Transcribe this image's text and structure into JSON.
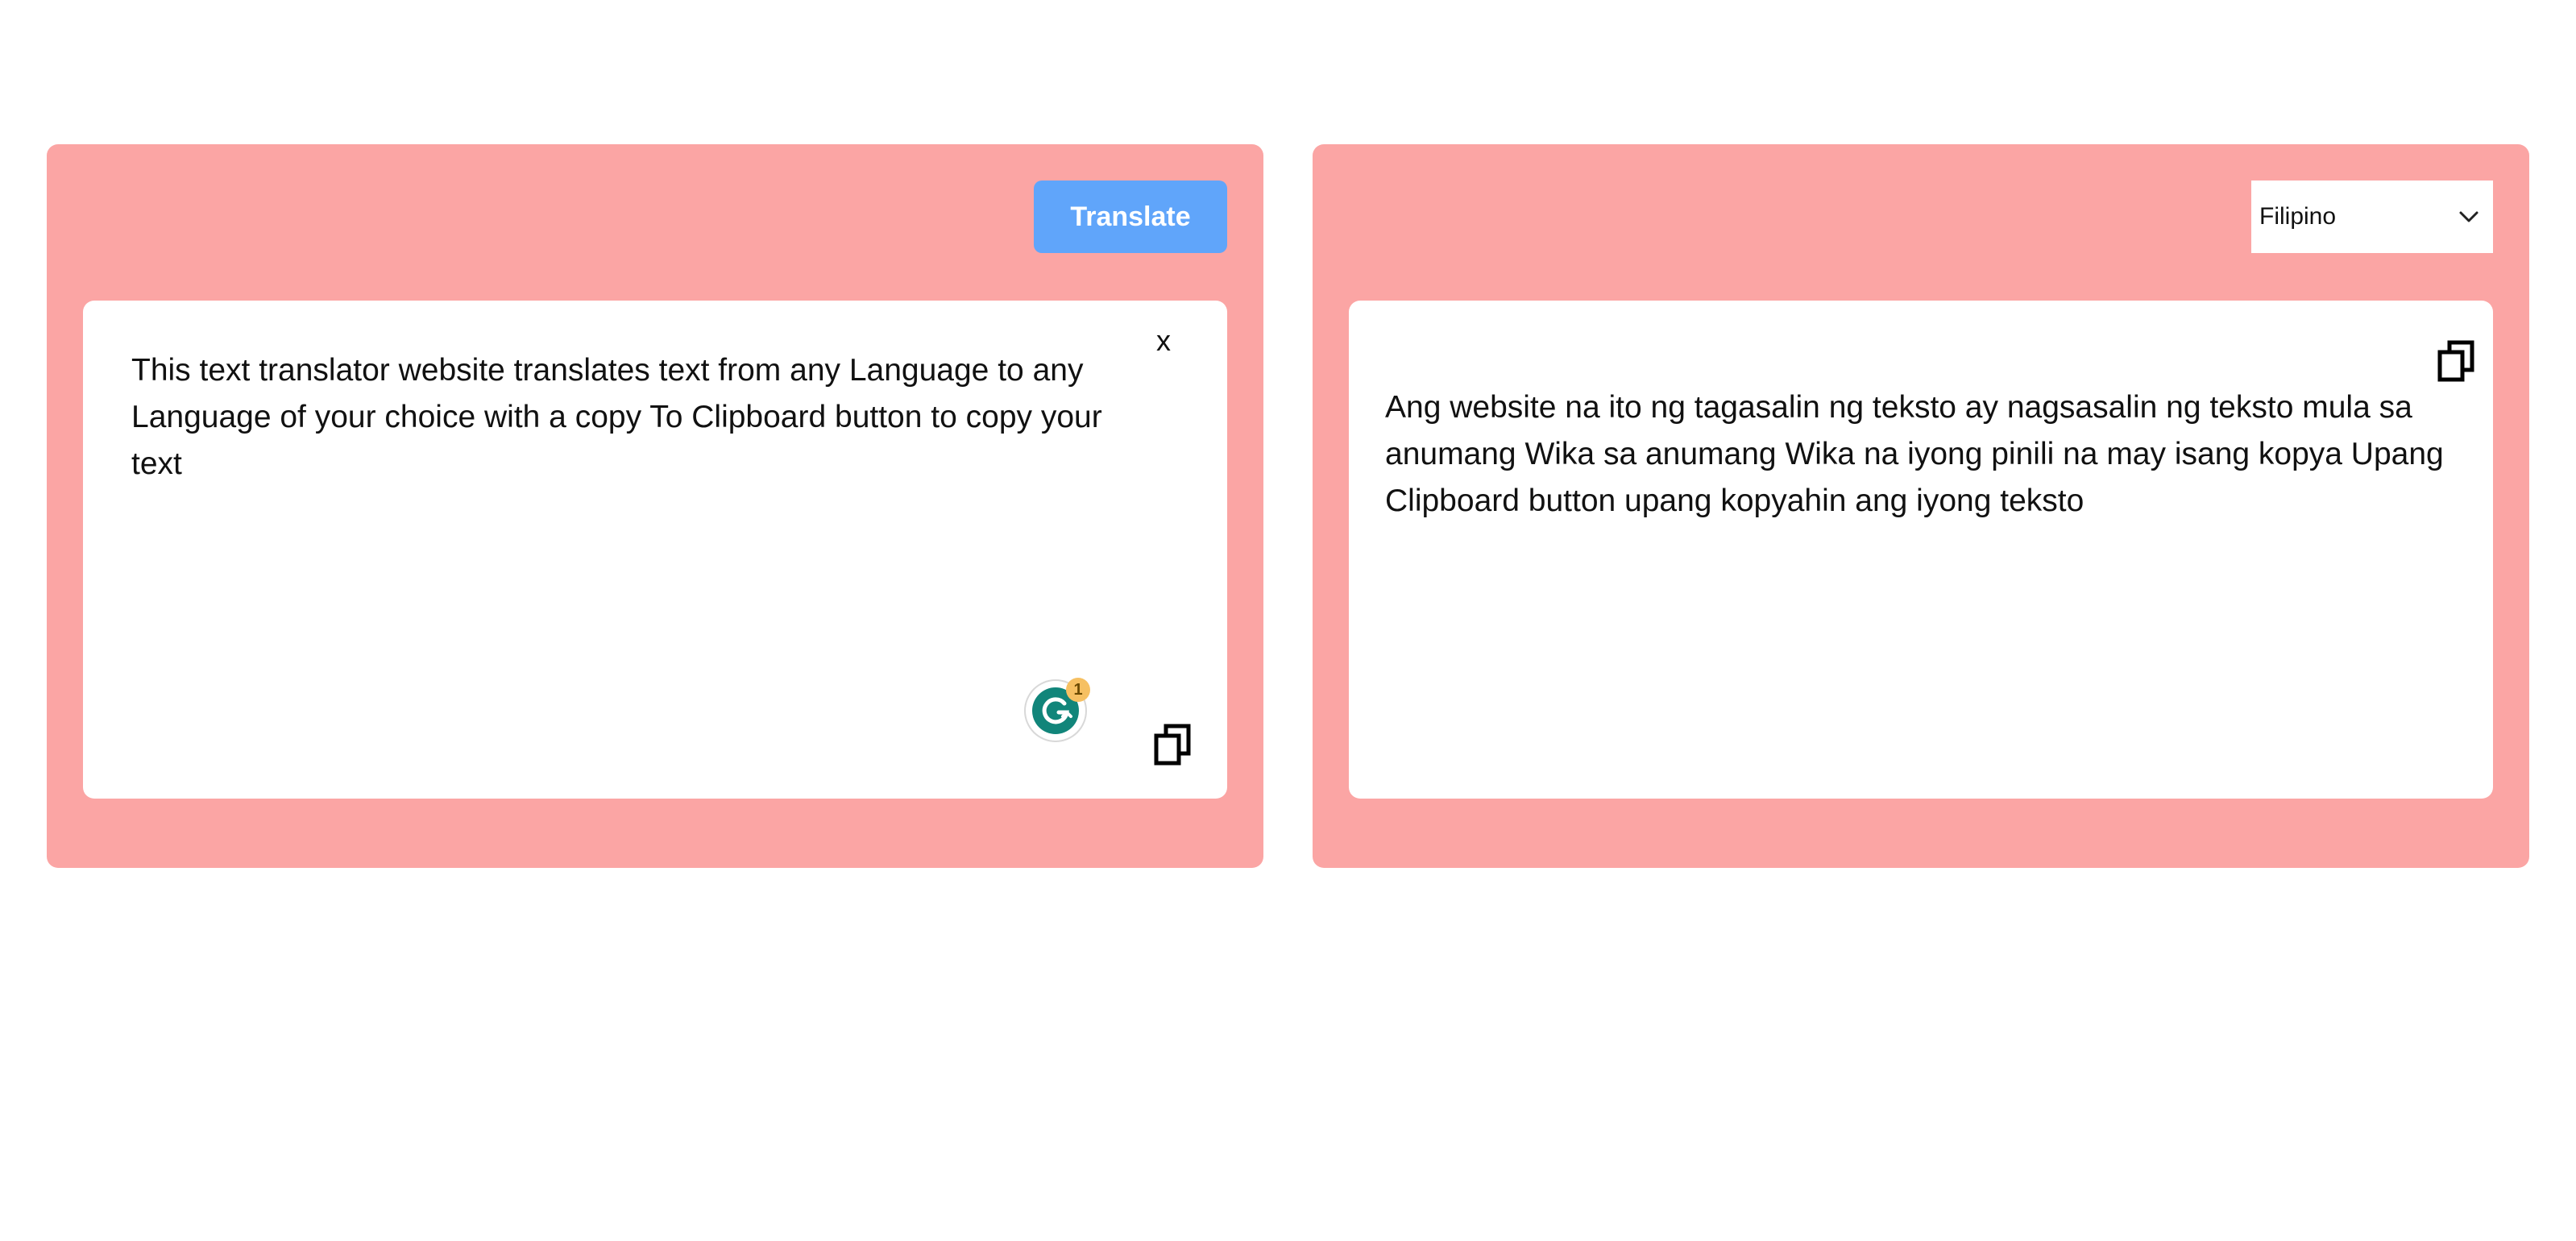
{
  "source_panel": {
    "translate_label": "Translate",
    "clear_label": "x",
    "text": "This text translator website translates text from any Language to any Language of your choice with a copy To Clipboard button to copy your text",
    "grammarly_count": "1"
  },
  "target_panel": {
    "selected_language": "Filipino",
    "text": "Ang website na ito ng tagasalin ng teksto ay nagsasalin ng teksto mula sa anumang Wika sa anumang Wika na iyong pinili na may isang kopya Upang Clipboard button upang kopyahin ang iyong teksto"
  },
  "icons": {
    "copy": "copy-icon",
    "chevron": "chevron-down-icon",
    "grammarly": "grammarly-icon"
  },
  "colors": {
    "panel_bg": "#fba5a4",
    "button_bg": "#60a5fa",
    "grammarly_green": "#11857a",
    "badge": "#f6c062"
  }
}
